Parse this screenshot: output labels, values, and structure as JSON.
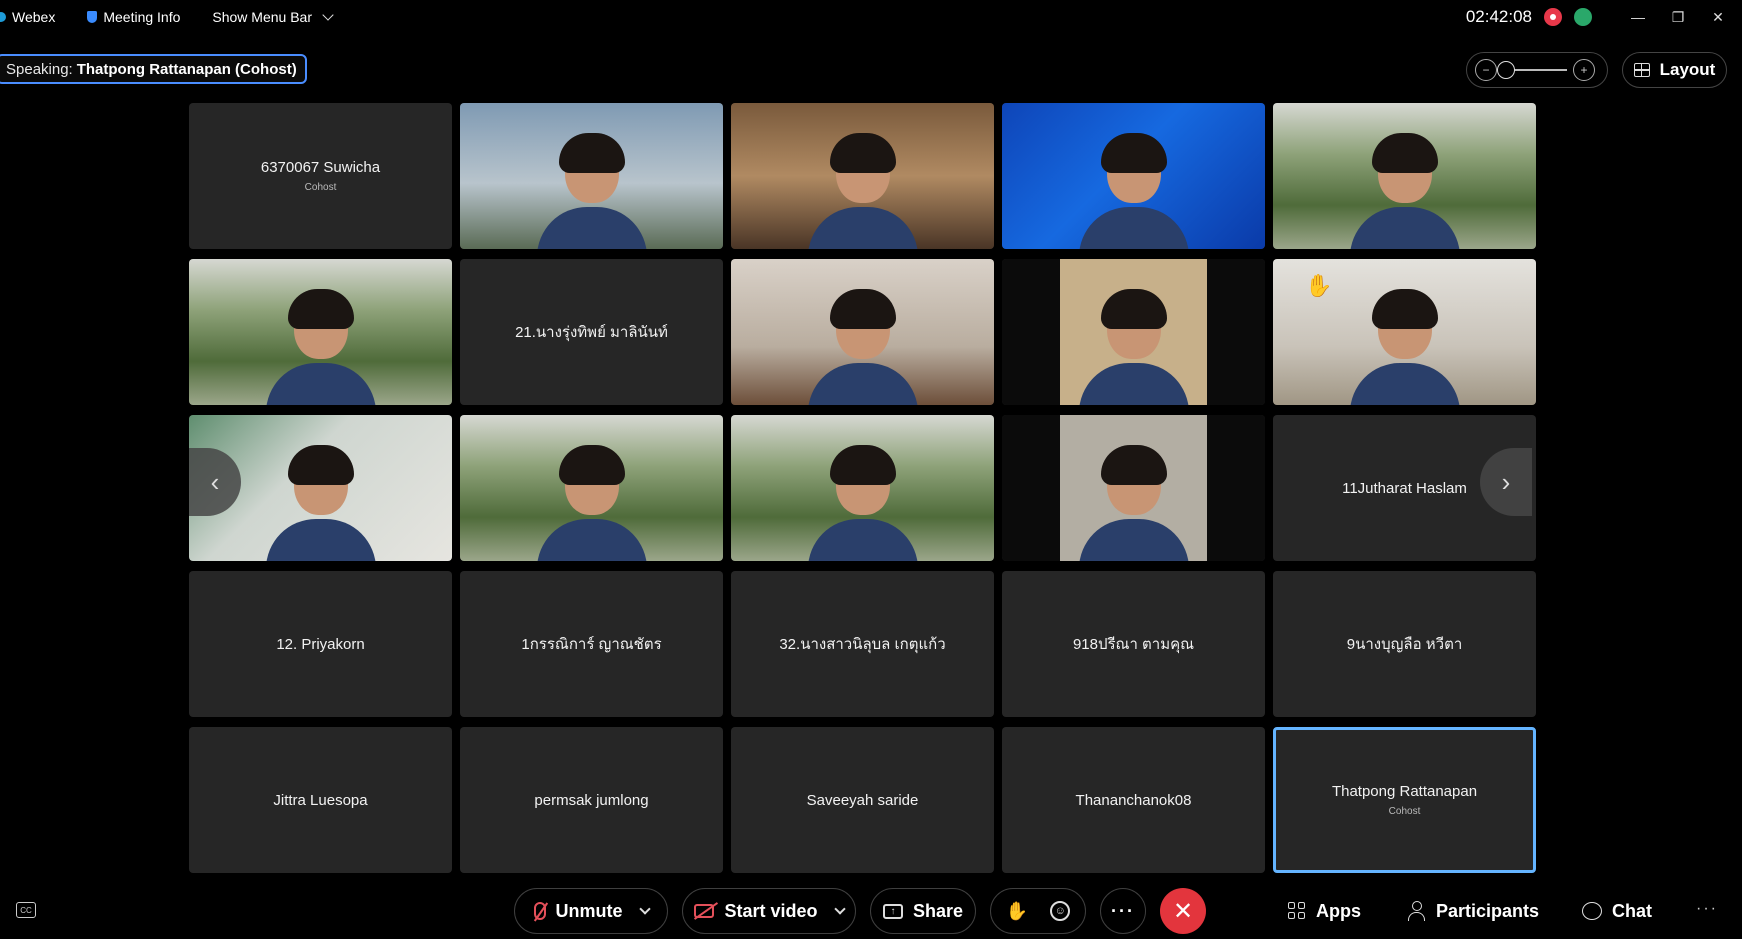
{
  "topbar": {
    "app_name": "Webex",
    "meeting_info": "Meeting Info",
    "menu_bar": "Show Menu Bar",
    "clock": "02:42:08"
  },
  "speaking": {
    "label": "Speaking:",
    "name": "Thatpong Rattanapan (Cohost)"
  },
  "layout_button": "Layout",
  "participants": [
    {
      "name": "6370067 Suwicha",
      "role": "Cohost",
      "video": false
    },
    {
      "name": "",
      "video": true,
      "bg": "sky"
    },
    {
      "name": "",
      "video": true,
      "bg": "room"
    },
    {
      "name": "",
      "video": true,
      "bg": "blue"
    },
    {
      "name": "",
      "video": true,
      "bg": "trees"
    },
    {
      "name": "",
      "video": true,
      "bg": "trees"
    },
    {
      "name": "21.นางรุ่งทิพย์ มาลินันท์",
      "video": false
    },
    {
      "name": "",
      "video": true,
      "bg": "wall"
    },
    {
      "name": "",
      "video": true,
      "bg": "pillar"
    },
    {
      "name": "",
      "video": true,
      "bg": "art",
      "raised_hand": true
    },
    {
      "name": "",
      "video": true,
      "bg": "class"
    },
    {
      "name": "",
      "video": true,
      "bg": "trees"
    },
    {
      "name": "",
      "video": true,
      "bg": "trees"
    },
    {
      "name": "",
      "video": true,
      "bg": "pillar2"
    },
    {
      "name": "11Jutharat Haslam",
      "video": false
    },
    {
      "name": "12. Priyakorn",
      "video": false
    },
    {
      "name": "1กรรณิการ์ ญาณชัตร",
      "video": false
    },
    {
      "name": "32.นางสาวนิลุบล เกตุแก้ว",
      "video": false
    },
    {
      "name": "918ปรีณา ตามคุณ",
      "video": false
    },
    {
      "name": "9นางบุญลือ หวีตา",
      "video": false
    },
    {
      "name": "Jittra Luesopa",
      "video": false
    },
    {
      "name": "permsak jumlong",
      "video": false
    },
    {
      "name": "Saveeyah saride",
      "video": false
    },
    {
      "name": "Thananchanok08",
      "video": false
    },
    {
      "name": "Thatpong Rattanapan",
      "role": "Cohost",
      "video": false,
      "active": true
    }
  ],
  "controls": {
    "unmute": "Unmute",
    "start_video": "Start video",
    "share": "Share",
    "apps": "Apps",
    "participants": "Participants",
    "chat": "Chat"
  },
  "colors": {
    "accent": "#64b4ff",
    "end_call": "#e3353d",
    "tile_bg": "#262626"
  }
}
